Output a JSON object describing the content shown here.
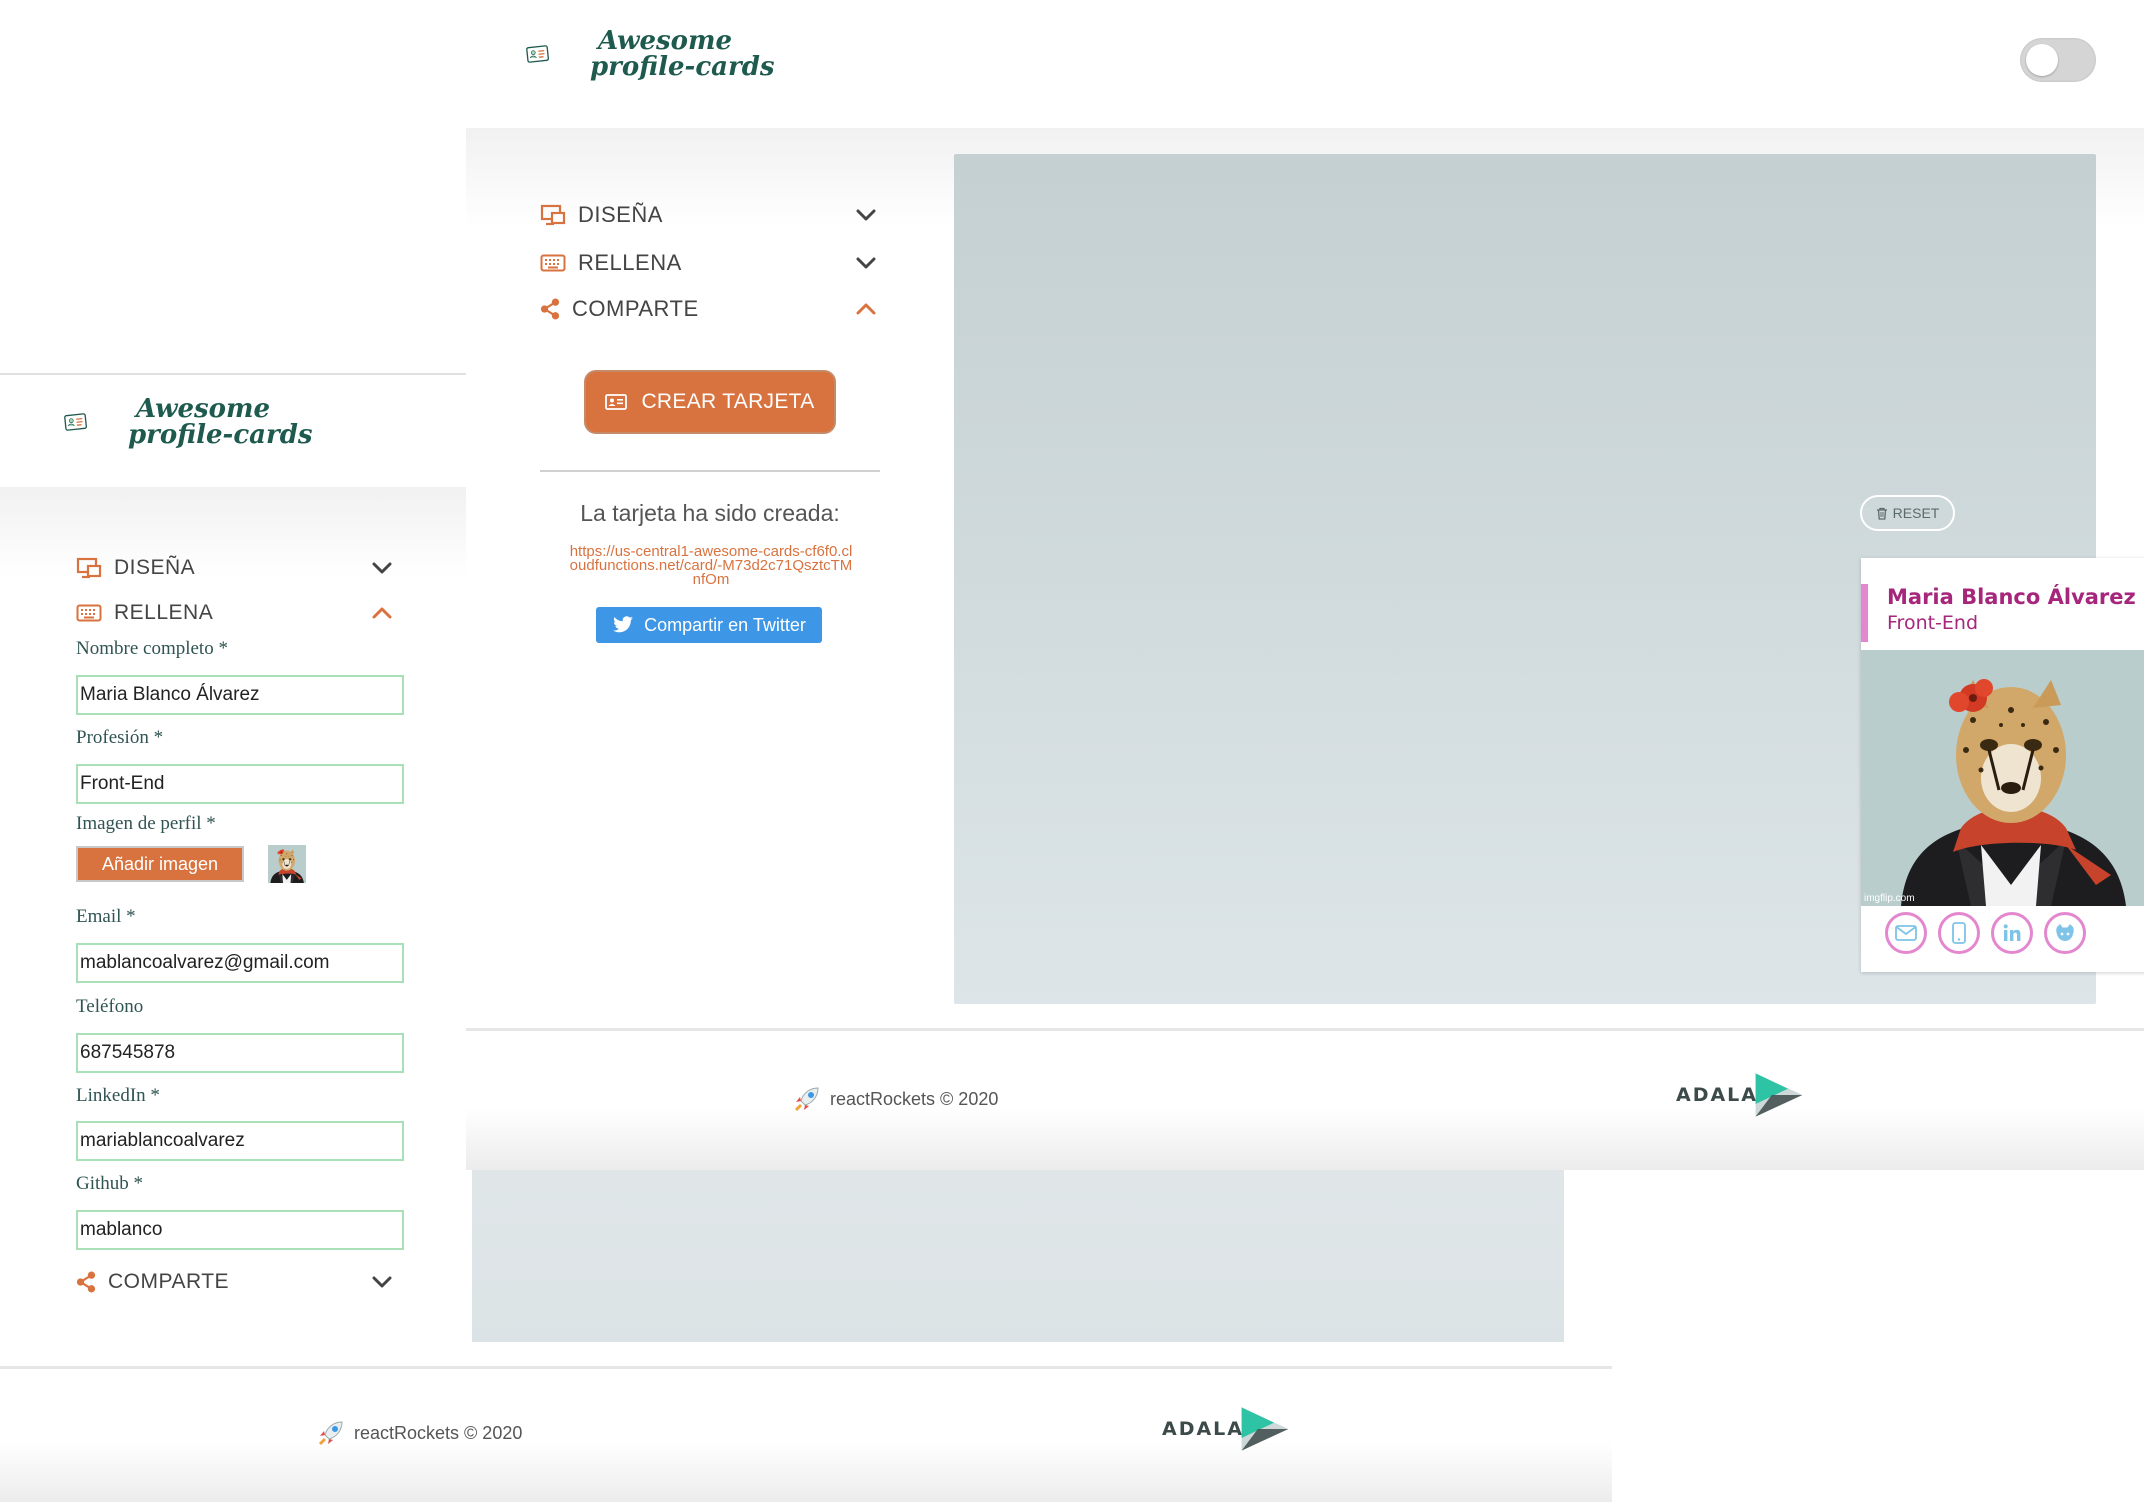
{
  "brand": {
    "logo_line1": "Awesome",
    "logo_line2": "profile-cards"
  },
  "colors": {
    "accent": "#d8733f",
    "card_accent": "#a5267b",
    "card_border": "#e388cf",
    "input_border": "#a9e0b5",
    "twitter": "#3e97e6"
  },
  "front": {
    "sections": [
      {
        "icon": "design-icon",
        "label": "DISEÑA",
        "open": false
      },
      {
        "icon": "keyboard-icon",
        "label": "RELLENA",
        "open": false
      },
      {
        "icon": "share-icon",
        "label": "COMPARTE",
        "open": true
      }
    ],
    "share": {
      "create_button": "CREAR TARJETA",
      "created_message": "La tarjeta ha sido creada:",
      "card_url": "https://us-central1-awesome-cards-cf6f0.cloudfunctions.net/card/-M73d2c71QsztcTMnfOm",
      "twitter_button": "Compartir en Twitter"
    },
    "preview": {
      "reset_label": "RESET",
      "name": "Maria Blanco Álvarez",
      "job": "Front-End",
      "photo_watermark": "imgflip.com",
      "social_icons": [
        "mail-icon",
        "phone-icon",
        "linkedin-icon",
        "github-icon"
      ]
    },
    "footer": {
      "copyright": "reactRockets © 2020",
      "logo": "ADALAB"
    }
  },
  "back": {
    "sections": [
      {
        "icon": "design-icon",
        "label": "DISEÑA",
        "open": false
      },
      {
        "icon": "keyboard-icon",
        "label": "RELLENA",
        "open": true
      },
      {
        "icon": "share-icon",
        "label": "COMPARTE",
        "open": false
      }
    ],
    "form": {
      "name_label": "Nombre completo *",
      "name_value": "Maria Blanco Álvarez",
      "job_label": "Profesión *",
      "job_value": "Front-End",
      "image_label": "Imagen de perfil *",
      "image_button": "Añadir imagen",
      "email_label": "Email *",
      "email_value": "mablancoalvarez@gmail.com",
      "phone_label": "Teléfono",
      "phone_value": "687545878",
      "linkedin_label": "LinkedIn *",
      "linkedin_value": "mariablancoalvarez",
      "github_label": "Github *",
      "github_value": "mablanco"
    },
    "footer": {
      "copyright": "reactRockets © 2020",
      "logo": "ADALAB"
    }
  }
}
